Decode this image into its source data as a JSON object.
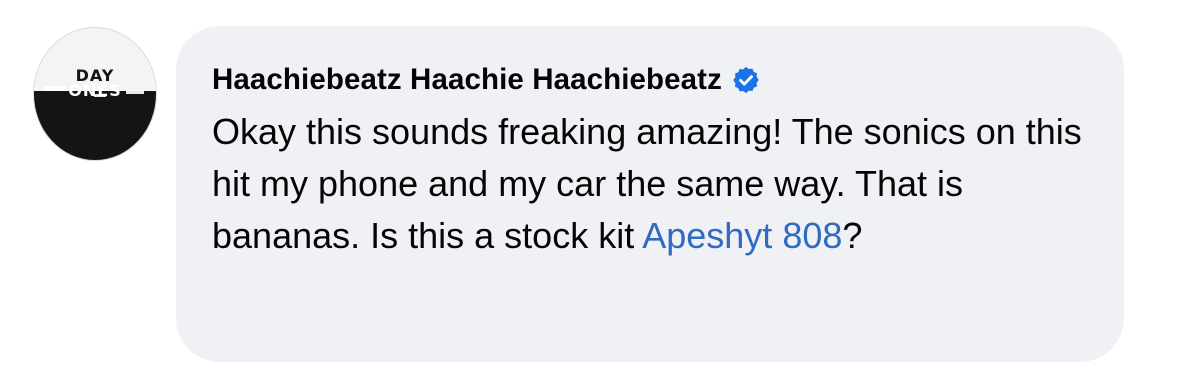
{
  "comment": {
    "author": "Haachiebeatz Haachie Haachiebeatz",
    "verified": true,
    "text_before_tag": "Okay this sounds freaking amazing! The sonics on this hit my phone and my car the same way. That is bananas. Is this a stock kit ",
    "tag": "Apeshyt 808",
    "text_after_tag": "?"
  },
  "avatar": {
    "logo_line1": "DAY",
    "logo_line2": "ONES",
    "top_small_text": "",
    "bottom_small_text": ""
  },
  "colors": {
    "bubble": "#f0f1f5",
    "tag": "#2f6bc0",
    "verified": "#1d72e8",
    "text": "#050505"
  },
  "icons": {
    "verified": "verified-badge-icon"
  }
}
